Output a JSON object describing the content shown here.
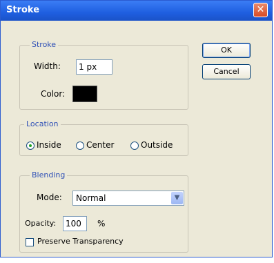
{
  "window": {
    "title": "Stroke",
    "close_glyph": "✕"
  },
  "stroke": {
    "legend": "Stroke",
    "width_label": "Width:",
    "width_value": "1 px",
    "color_label": "Color:",
    "color_value": "#000000"
  },
  "location": {
    "legend": "Location",
    "options": [
      "Inside",
      "Center",
      "Outside"
    ],
    "selected": "Inside"
  },
  "blending": {
    "legend": "Blending",
    "mode_label": "Mode:",
    "mode_value": "Normal",
    "opacity_label": "Opacity:",
    "opacity_value": "100",
    "opacity_unit": "%",
    "preserve_label": "Preserve Transparency",
    "preserve_checked": false
  },
  "buttons": {
    "ok": "OK",
    "cancel": "Cancel"
  },
  "icons": {
    "dropdown": "chevron-down-icon"
  }
}
